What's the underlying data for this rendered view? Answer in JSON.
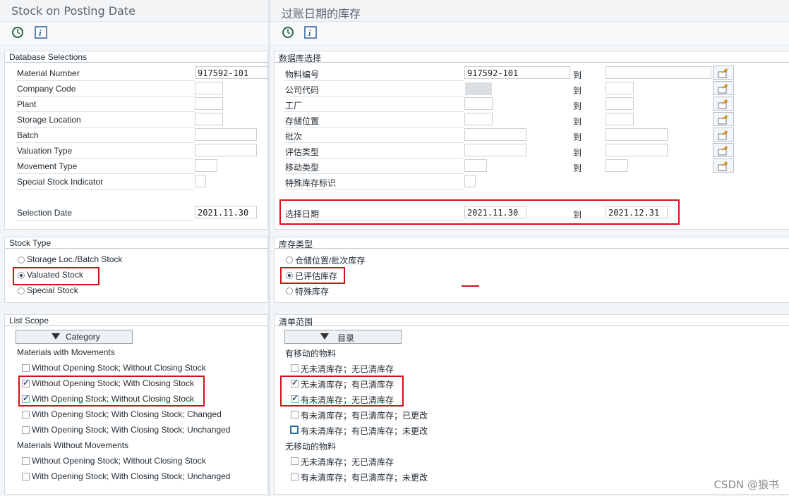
{
  "en": {
    "title": "Stock on Posting Date",
    "db": {
      "title": "Database Selections",
      "material_number": "Material Number",
      "material_value": "917592-101",
      "company_code": "Company Code",
      "plant": "Plant",
      "storage_location": "Storage Location",
      "batch": "Batch",
      "valuation_type": "Valuation Type",
      "movement_type": "Movement Type",
      "special_stock_indicator": "Special Stock Indicator",
      "selection_date": "Selection Date",
      "selection_date_value": "2021.11.30"
    },
    "stock": {
      "title": "Stock Type",
      "opt1": "Storage Loc./Batch Stock",
      "opt2": "Valuated Stock",
      "opt3": "Special Stock"
    },
    "scope": {
      "title": "List Scope",
      "button": "Category",
      "with_mov": "Materials with Movements",
      "c1": "Without Opening Stock; Without Closing Stock",
      "c2": "Without Opening Stock; With Closing Stock",
      "c3": "With Opening Stock; Without Closing Stock",
      "c4": "With Opening Stock; With Closing Stock; Changed",
      "c5": "With Opening Stock; With Closing Stock; Unchanged",
      "without_mov": "Materials Without Movements",
      "c6": "Without Opening Stock; Without Closing Stock",
      "c7": "With Opening Stock; With Closing Stock; Unchanged"
    }
  },
  "zh": {
    "title": "过账日期的库存",
    "db": {
      "title": "数据库选择",
      "material_number": "物料编号",
      "material_value": "917592-101",
      "company_code": "公司代码",
      "plant": "工厂",
      "storage_location": "存储位置",
      "batch": "批次",
      "valuation_type": "评估类型",
      "movement_type": "移动类型",
      "special_stock_indicator": "特殊库存标识",
      "selection_date": "选择日期",
      "selection_date_from": "2021.11.30",
      "selection_date_to": "2021.12.31",
      "to": "到"
    },
    "stock": {
      "title": "库存类型",
      "opt1": "仓储位置/批次库存",
      "opt2": "已评估库存",
      "opt3": "特殊库存"
    },
    "scope": {
      "title": "清单范围",
      "button": "目录",
      "with_mov": "有移动的物料",
      "c1": "无未清库存；无已清库存",
      "c2": "无未清库存；有已清库存",
      "c3": "有未清库存；无已清库存",
      "c4": "有未清库存；有已清库存；已更改",
      "c5": "有未清库存；有已清库存；未更改",
      "without_mov": "无移动的物料",
      "c6": "无未清库存；无已清库存",
      "c7": "有未清库存；有已清库存；未更改"
    }
  },
  "state": {
    "stock_selected": "opt2",
    "checked": [
      "c2",
      "c3"
    ]
  },
  "watermark": "CSDN @狼书",
  "colors": {
    "highlight": "#d0121b",
    "accent": "#1e5a86"
  }
}
